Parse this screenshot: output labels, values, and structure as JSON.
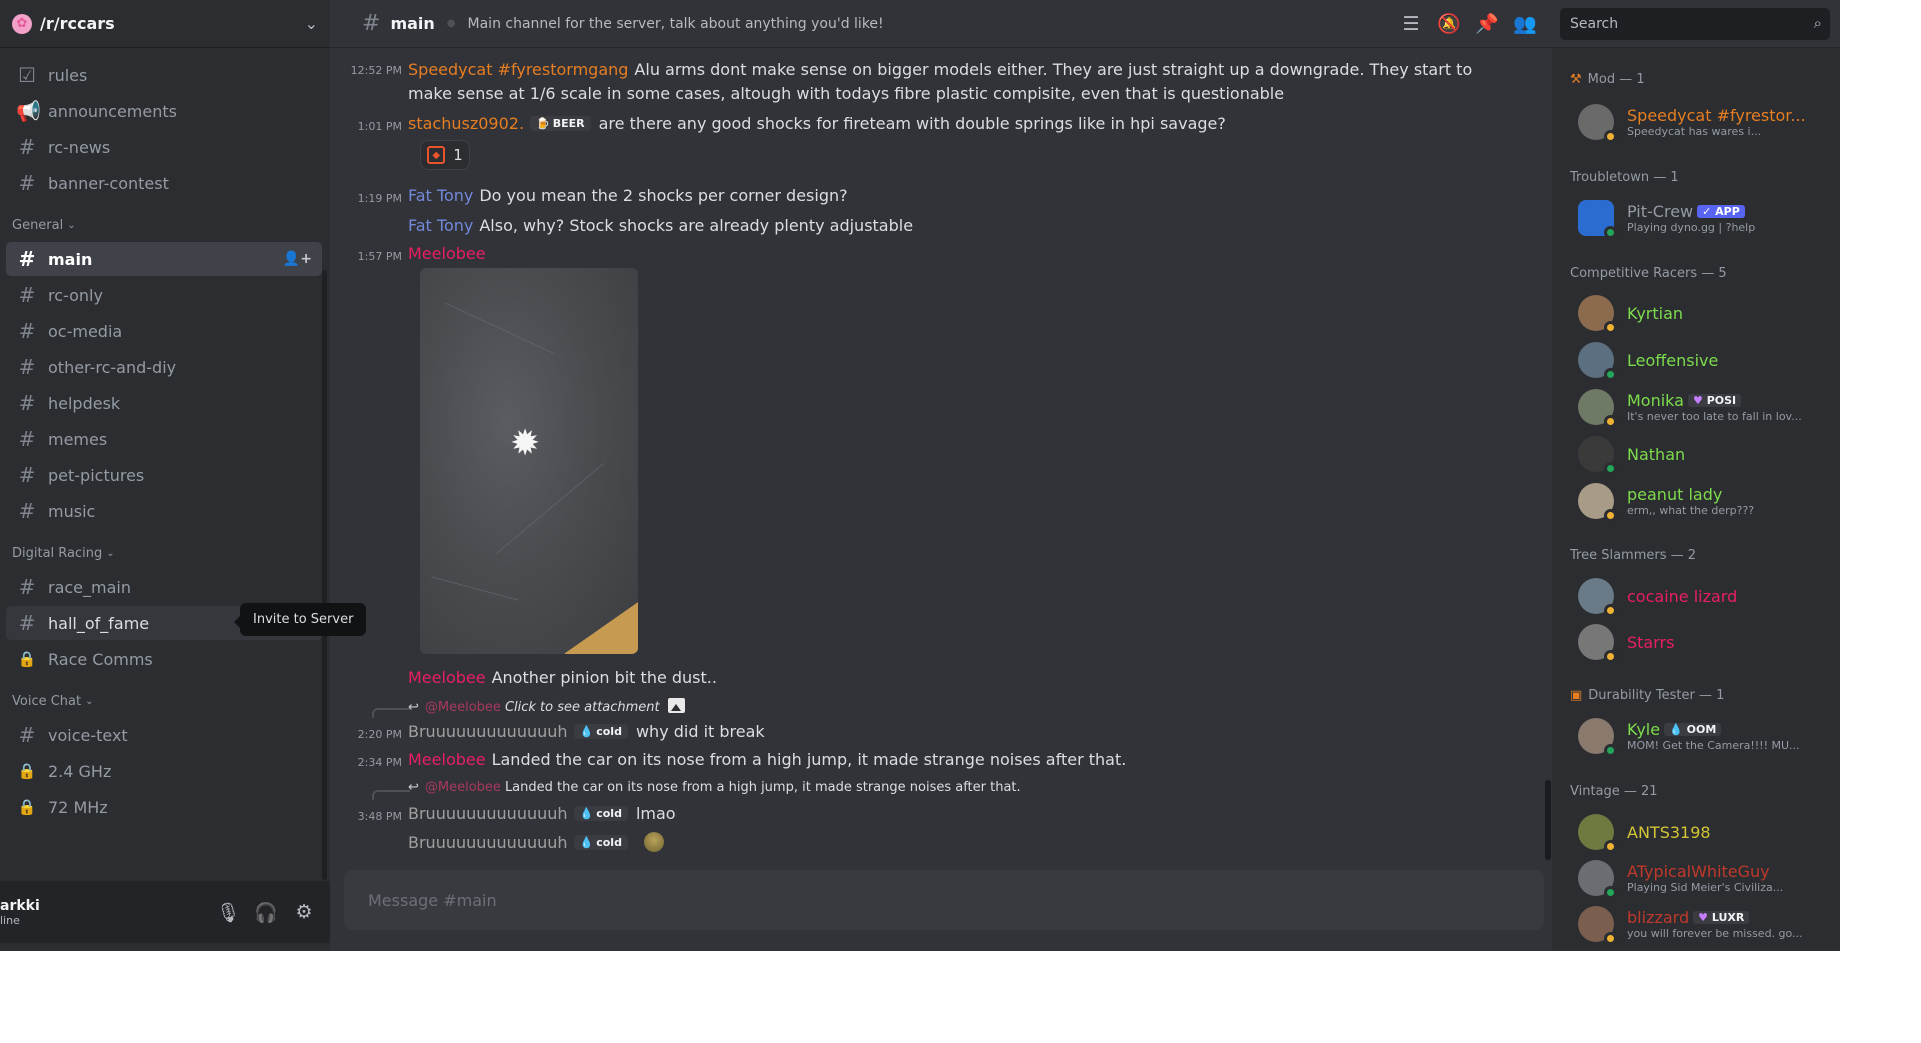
{
  "server": {
    "name": "/r/rccars"
  },
  "channels": {
    "top": [
      {
        "icon": "☑",
        "label": "rules"
      },
      {
        "icon": "📢",
        "label": "announcements"
      },
      {
        "icon": "#",
        "label": "rc-news"
      },
      {
        "icon": "#",
        "label": "banner-contest"
      }
    ],
    "general_label": "General",
    "general": [
      {
        "icon": "#",
        "label": "main",
        "active": true
      },
      {
        "icon": "#",
        "label": "rc-only"
      },
      {
        "icon": "#",
        "label": "oc-media"
      },
      {
        "icon": "#",
        "label": "other-rc-and-diy"
      },
      {
        "icon": "#",
        "label": "helpdesk"
      },
      {
        "icon": "#",
        "label": "memes"
      },
      {
        "icon": "#",
        "label": "pet-pictures"
      },
      {
        "icon": "#",
        "label": "music"
      }
    ],
    "digital_label": "Digital Racing",
    "digital": [
      {
        "icon": "#",
        "label": "race_main"
      },
      {
        "icon": "#",
        "label": "hall_of_fame"
      },
      {
        "icon": "🔒",
        "label": "Race Comms"
      }
    ],
    "voice_label": "Voice Chat",
    "voice": [
      {
        "icon": "#",
        "label": "voice-text"
      },
      {
        "icon": "🔒",
        "label": "2.4 GHz"
      },
      {
        "icon": "🔒",
        "label": "72 MHz"
      }
    ]
  },
  "tooltip": "Invite to Server",
  "user": {
    "name": "arkki",
    "status": "line"
  },
  "header": {
    "channel": "main",
    "topic": "Main channel for the server, talk about anything you'd like!",
    "search_placeholder": "Search"
  },
  "messages": [
    {
      "time": "12:52 PM",
      "author": "Speedycat #fyrestormgang",
      "color": "#e67e22",
      "text": "Alu arms dont make sense on bigger models either. They are just straight up a downgrade. They start to make sense at 1/6 scale in some cases, altough with todays fibre plastic compisite, even that is questionable"
    },
    {
      "time": "1:01 PM",
      "author": "stachusz0902.",
      "color": "#e67e22",
      "badge": "BEER",
      "text": "are there any good shocks  for fireteam with double springs like in hpi savage?",
      "reaction_count": "1"
    },
    {
      "time": "1:19 PM",
      "author": "Fat Tony",
      "color": "#7289da",
      "text": "Do you mean the 2 shocks per corner design?"
    },
    {
      "author": "Fat Tony",
      "color": "#7289da",
      "text": "Also, why? Stock shocks are already plenty adjustable"
    },
    {
      "time": "1:57 PM",
      "author": "Meelobee",
      "color": "#e91e63"
    },
    {
      "author": "Meelobee",
      "color": "#e91e63",
      "text": "Another pinion bit the dust.."
    },
    {
      "reply_mention": "@Meelobee",
      "reply_text": "Click to see attachment",
      "time": "2:20 PM",
      "author": "Bruuuuuuuuuuuuuh",
      "color": "#a0a0a0",
      "badge": "cold",
      "text": "why did it break"
    },
    {
      "time": "2:34 PM",
      "author": "Meelobee",
      "color": "#e91e63",
      "text": "Landed the car on its nose from a high jump, it made strange noises after that."
    },
    {
      "reply_mention": "@Meelobee",
      "reply_text": "Landed the car on its nose from a high jump, it made strange noises after that.",
      "time": "3:48 PM",
      "author": "Bruuuuuuuuuuuuuh",
      "color": "#a0a0a0",
      "badge": "cold",
      "text": "lmao"
    },
    {
      "author": "Bruuuuuuuuuuuuuh",
      "color": "#a0a0a0",
      "badge": "cold"
    }
  ],
  "composer": {
    "placeholder": "Message #main"
  },
  "members": {
    "groups": [
      {
        "label": "Mod — 1"
      },
      {
        "label": "Troubletown — 1"
      },
      {
        "label": "Competitive Racers — 5"
      },
      {
        "label": "Tree Slammers — 2"
      },
      {
        "label": "Durability Tester — 1"
      },
      {
        "label": "Vintage — 21"
      }
    ],
    "list": [
      {
        "name": "Speedycat #fyrestor...",
        "color": "#e67e22",
        "status": "Speedycat has wares i...",
        "avatar": "#6a6a6a",
        "presence": "#f0b232"
      },
      {
        "name": "Pit-Crew",
        "color": "#949ba4",
        "badge": "✓ APP",
        "status": "Playing dyno.gg | ?help",
        "avatar": "#2b6cd1",
        "presence": "#23a55a"
      },
      {
        "name": "Kyrtian",
        "color": "#7ddc4c",
        "avatar": "#8b6a4e",
        "presence": "#f0b232"
      },
      {
        "name": "Leoffensive",
        "color": "#7ddc4c",
        "avatar": "#5b6f80",
        "presence": "#23a55a"
      },
      {
        "name": "Monika",
        "color": "#7ddc4c",
        "badge": "POSI",
        "status": "It's never too late to fall in lov...",
        "avatar": "#6f7a66",
        "presence": "#f0b232"
      },
      {
        "name": "Nathan",
        "color": "#7ddc4c",
        "avatar": "#3a3a3a",
        "presence": "#23a55a"
      },
      {
        "name": "peanut lady",
        "color": "#7ddc4c",
        "status": "erm,, what the derp???",
        "avatar": "#a89b88",
        "presence": "#f0b232"
      },
      {
        "name": "cocaine lizard",
        "color": "#e91e63",
        "avatar": "#6a7a86",
        "presence": "#f0b232"
      },
      {
        "name": "Starrs",
        "color": "#e91e63",
        "avatar": "#777777",
        "presence": "#f0b232"
      },
      {
        "name": "Kyle",
        "color": "#7ddc4c",
        "badge": "OOM",
        "status": "MOM! Get the Camera!!!! MU...",
        "avatar": "#8a7a6e",
        "presence": "#23a55a"
      },
      {
        "name": "ANTS3198",
        "color": "#d3c634",
        "avatar": "#6e7a40",
        "presence": "#f0b232"
      },
      {
        "name": "ATypicalWhiteGuy",
        "color": "#c0392b",
        "status": "Playing Sid Meier's Civiliza...",
        "avatar": "#6a6e72",
        "presence": "#23a55a"
      },
      {
        "name": "blizzard",
        "color": "#c0392b",
        "badge": "LUXR",
        "status": "you will forever be missed. go...",
        "avatar": "#7a5e4e",
        "presence": "#f0b232"
      }
    ]
  }
}
